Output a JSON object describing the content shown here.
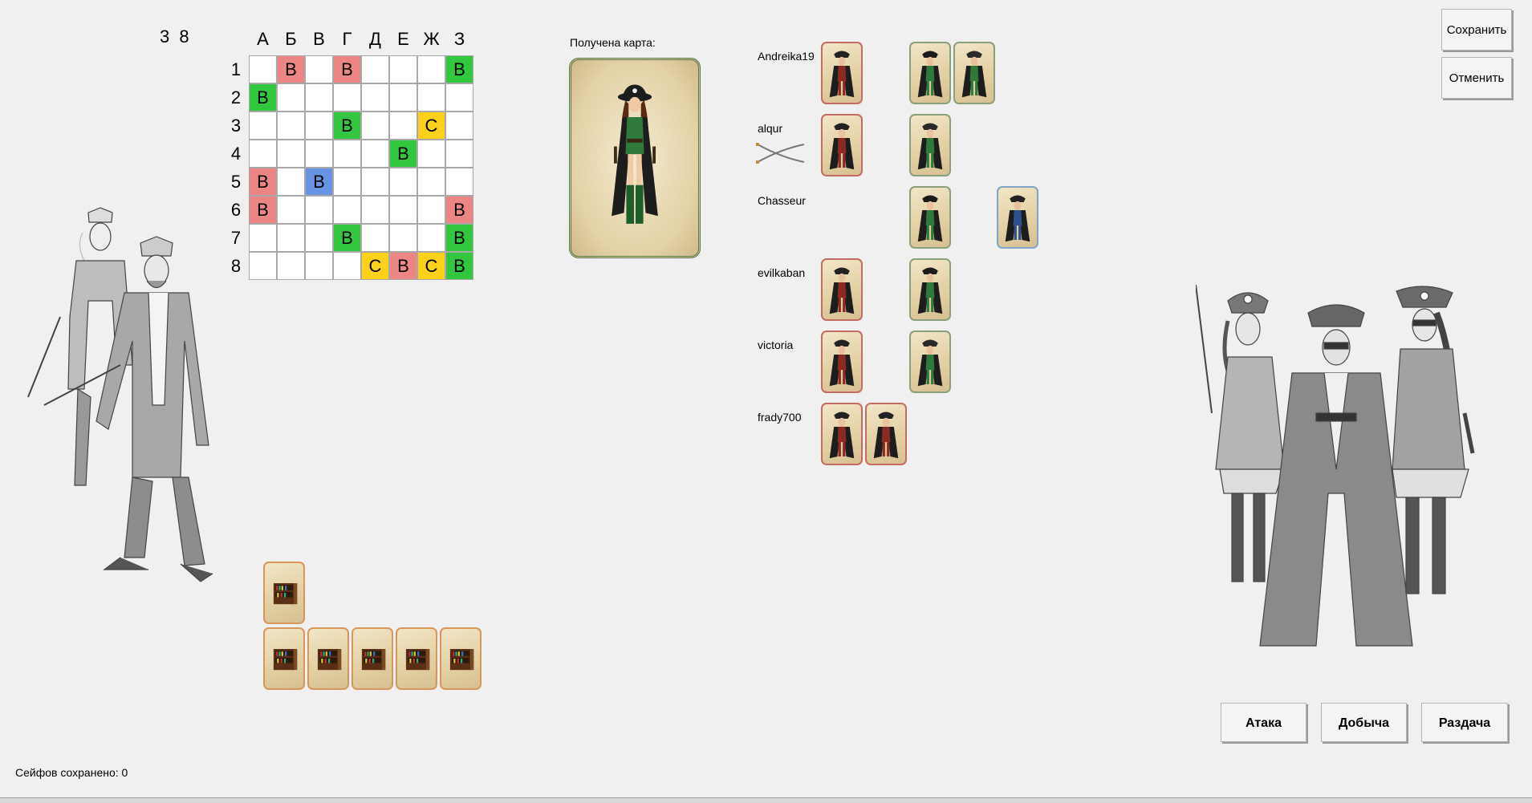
{
  "counter": "3 8",
  "board": {
    "columns": [
      "А",
      "Б",
      "В",
      "Г",
      "Д",
      "Е",
      "Ж",
      "З"
    ],
    "rows": [
      "1",
      "2",
      "3",
      "4",
      "5",
      "6",
      "7",
      "8"
    ],
    "cells": [
      {
        "r": 0,
        "c": 1,
        "t": "B",
        "color": "red"
      },
      {
        "r": 0,
        "c": 3,
        "t": "B",
        "color": "red"
      },
      {
        "r": 0,
        "c": 7,
        "t": "B",
        "color": "green"
      },
      {
        "r": 1,
        "c": 0,
        "t": "B",
        "color": "green"
      },
      {
        "r": 2,
        "c": 3,
        "t": "B",
        "color": "green"
      },
      {
        "r": 2,
        "c": 6,
        "t": "C",
        "color": "yellow"
      },
      {
        "r": 3,
        "c": 5,
        "t": "B",
        "color": "green"
      },
      {
        "r": 4,
        "c": 0,
        "t": "B",
        "color": "red"
      },
      {
        "r": 4,
        "c": 2,
        "t": "B",
        "color": "blue"
      },
      {
        "r": 5,
        "c": 0,
        "t": "B",
        "color": "red"
      },
      {
        "r": 5,
        "c": 7,
        "t": "B",
        "color": "red"
      },
      {
        "r": 6,
        "c": 3,
        "t": "B",
        "color": "green"
      },
      {
        "r": 6,
        "c": 7,
        "t": "B",
        "color": "green"
      },
      {
        "r": 7,
        "c": 4,
        "t": "C",
        "color": "yellow"
      },
      {
        "r": 7,
        "c": 5,
        "t": "B",
        "color": "red"
      },
      {
        "r": 7,
        "c": 6,
        "t": "C",
        "color": "yellow"
      },
      {
        "r": 7,
        "c": 7,
        "t": "B",
        "color": "green"
      }
    ],
    "colors": {
      "red": "#ec8685",
      "green": "#33c63f",
      "blue": "#6895e3",
      "yellow": "#fcd11a"
    }
  },
  "received": {
    "label": "Получена карта:",
    "card": "green-pirate-woman"
  },
  "players": [
    {
      "name": "Andreika19",
      "has_sabers": false,
      "cards": [
        {
          "slot": 0,
          "kind": "red-pirate",
          "border": "red"
        },
        {
          "slot": 2,
          "kind": "green-pirate-woman",
          "border": "green"
        },
        {
          "slot": 3,
          "kind": "green-pirate-man",
          "border": "green"
        }
      ]
    },
    {
      "name": "alqur",
      "has_sabers": true,
      "cards": [
        {
          "slot": 0,
          "kind": "red-pirate",
          "border": "red"
        },
        {
          "slot": 2,
          "kind": "green-pirate-man",
          "border": "green"
        }
      ]
    },
    {
      "name": "Chasseur",
      "has_sabers": false,
      "cards": [
        {
          "slot": 2,
          "kind": "green-pirate-woman",
          "border": "green"
        },
        {
          "slot": 4,
          "kind": "blue-pirate",
          "border": "blue"
        }
      ]
    },
    {
      "name": "evilkaban",
      "has_sabers": false,
      "cards": [
        {
          "slot": 0,
          "kind": "red-pirate",
          "border": "red"
        },
        {
          "slot": 2,
          "kind": "green-pirate-woman",
          "border": "green"
        }
      ]
    },
    {
      "name": "victoria",
      "has_sabers": false,
      "cards": [
        {
          "slot": 0,
          "kind": "red-pirate",
          "border": "red"
        },
        {
          "slot": 2,
          "kind": "green-pirate-man",
          "border": "green"
        }
      ]
    },
    {
      "name": "frady700",
      "has_sabers": false,
      "cards": [
        {
          "slot": 0,
          "kind": "red-pirate",
          "border": "red"
        },
        {
          "slot": 1,
          "kind": "red-pirate",
          "border": "red"
        }
      ]
    }
  ],
  "hand": {
    "top_row": [
      "bookcase"
    ],
    "bottom_row": [
      "bookcase",
      "bookcase",
      "bookcase",
      "bookcase",
      "bookcase"
    ]
  },
  "buttons": {
    "save": "Сохранить",
    "cancel": "Отменить",
    "attack": "Атака",
    "loot": "Добыча",
    "deal": "Раздача"
  },
  "status": {
    "safes_saved": "Сейфов сохранено: 0"
  }
}
